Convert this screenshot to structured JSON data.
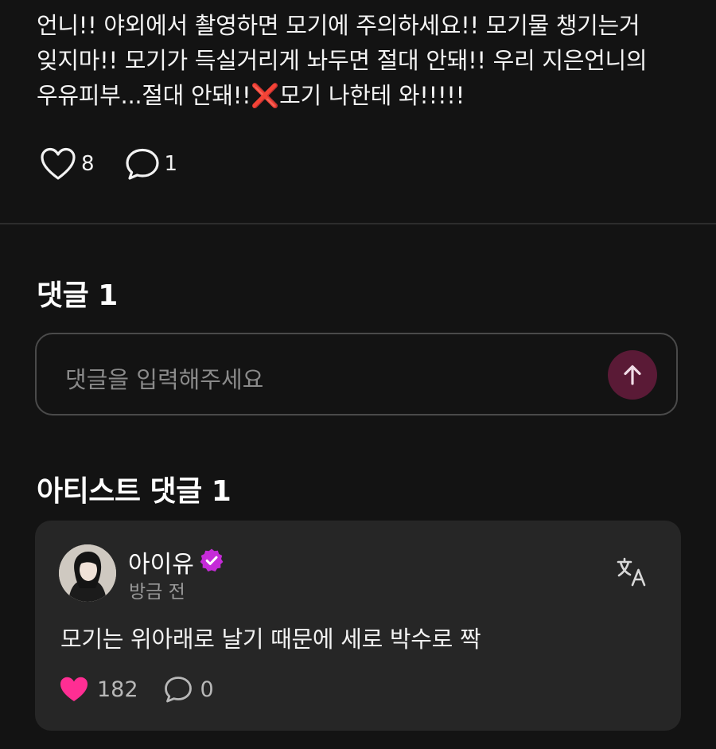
{
  "post": {
    "body": "언니!! 야외에서 촬영하면 모기에 주의하세요!! 모기물 챙기는거\n잊지마!! 모기가 득실거리게 놔두면 절대 안돼!! 우리 지은언니의\n우유피부...절대 안돼!!❌모기 나한테 와!!!!!",
    "likes": "8",
    "comments": "1"
  },
  "comments_section": {
    "title": "댓글 1",
    "input_placeholder": "댓글을 입력해주세요"
  },
  "artist_section": {
    "title": "아티스트 댓글 1",
    "comment": {
      "author": "아이유",
      "timestamp": "방금 전",
      "text": "모기는 위아래로 날기 때문에 세로 박수로 짝",
      "likes": "182",
      "replies": "0"
    }
  },
  "icons": {
    "like": "heart-outline-icon",
    "liked": "heart-filled-icon",
    "comment": "speech-bubble-icon",
    "send": "arrow-up-icon",
    "verified": "verified-badge-icon",
    "translate": "translate-icon"
  },
  "colors": {
    "background": "#131313",
    "card": "#262626",
    "accent_pink": "#ff2e93",
    "verified_purple": "#c52bd8",
    "send_button": "#5a1a36"
  }
}
